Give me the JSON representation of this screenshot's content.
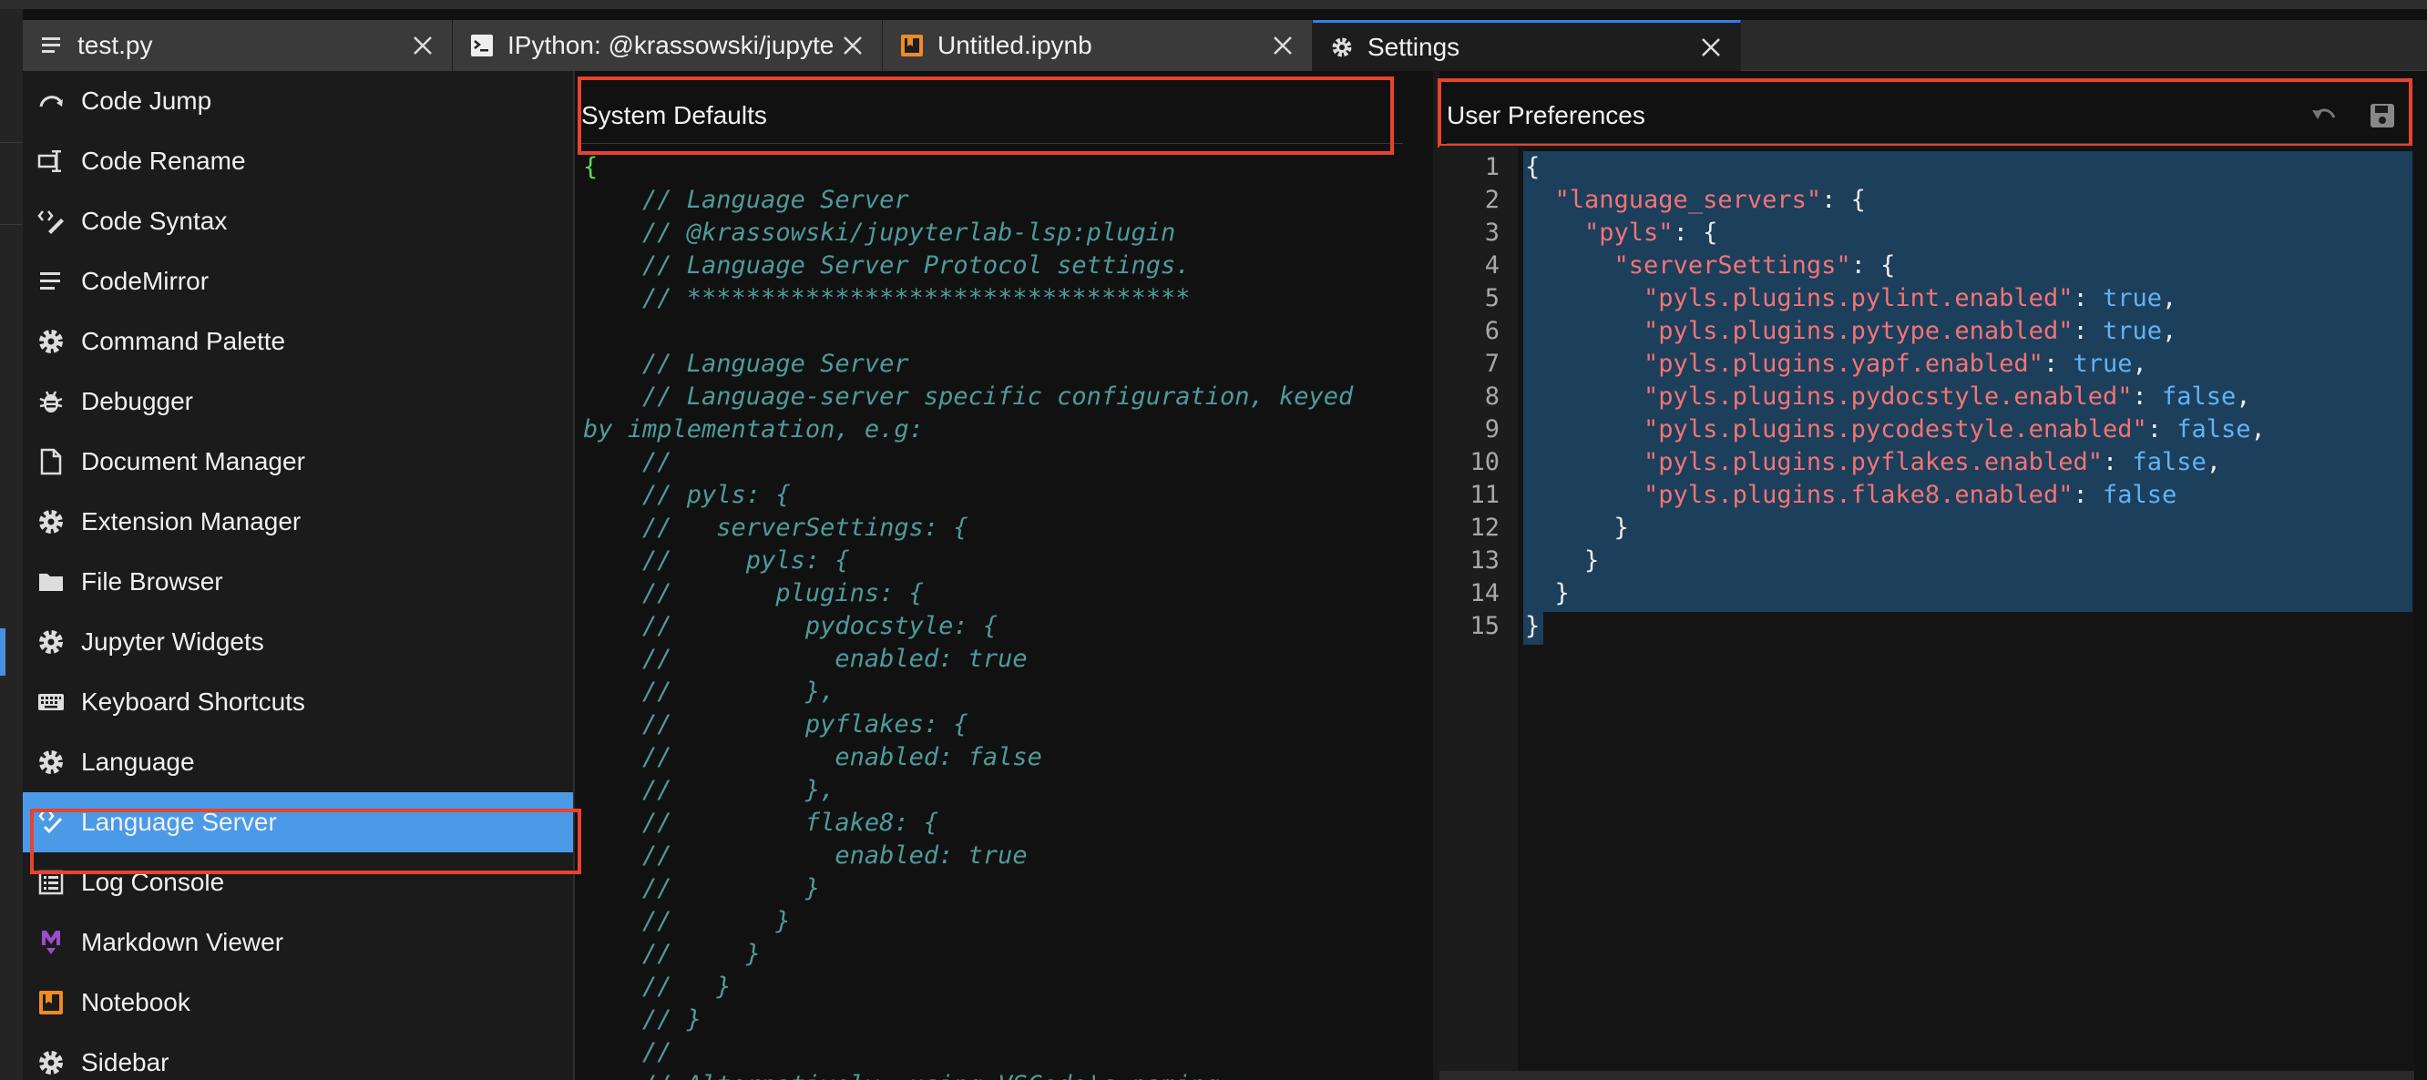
{
  "tabs": [
    {
      "label": "test.py",
      "icon": "text-file-icon"
    },
    {
      "label": "IPython: @krassowski/jupyterlab-lsp",
      "icon": "terminal-icon"
    },
    {
      "label": "Untitled.ipynb",
      "icon": "notebook-icon"
    },
    {
      "label": "Settings",
      "icon": "gear-icon"
    }
  ],
  "sidebar": {
    "items": [
      {
        "label": "Code Jump",
        "icon": "jump-icon"
      },
      {
        "label": "Code Rename",
        "icon": "rename-icon"
      },
      {
        "label": "Code Syntax",
        "icon": "syntax-icon"
      },
      {
        "label": "CodeMirror",
        "icon": "lines-icon"
      },
      {
        "label": "Command Palette",
        "icon": "gear-icon"
      },
      {
        "label": "Debugger",
        "icon": "bug-icon"
      },
      {
        "label": "Document Manager",
        "icon": "document-icon"
      },
      {
        "label": "Extension Manager",
        "icon": "gear-icon"
      },
      {
        "label": "File Browser",
        "icon": "folder-icon"
      },
      {
        "label": "Jupyter Widgets",
        "icon": "gear-icon"
      },
      {
        "label": "Keyboard Shortcuts",
        "icon": "keyboard-icon"
      },
      {
        "label": "Language",
        "icon": "gear-icon"
      },
      {
        "label": "Language Server",
        "icon": "language-server-icon"
      },
      {
        "label": "Log Console",
        "icon": "list-icon"
      },
      {
        "label": "Markdown Viewer",
        "icon": "markdown-icon"
      },
      {
        "label": "Notebook",
        "icon": "notebook-icon"
      },
      {
        "label": "Sidebar",
        "icon": "gear-icon"
      }
    ],
    "selected": "Language Server"
  },
  "system_defaults": {
    "title": "System Defaults",
    "lines": [
      "{",
      "    // Language Server",
      "    // @krassowski/jupyterlab-lsp:plugin",
      "    // Language Server Protocol settings.",
      "    // **********************************",
      "",
      "    // Language Server",
      "    // Language-server specific configuration, keyed",
      "by implementation, e.g:",
      "    //",
      "    // pyls: {",
      "    //   serverSettings: {",
      "    //     pyls: {",
      "    //       plugins: {",
      "    //         pydocstyle: {",
      "    //           enabled: true",
      "    //         },",
      "    //         pyflakes: {",
      "    //           enabled: false",
      "    //         },",
      "    //         flake8: {",
      "    //           enabled: true",
      "    //         }",
      "    //       }",
      "    //     }",
      "    //   }",
      "    // }",
      "    //",
      "    // Alternatively, using VSCode's naming"
    ]
  },
  "user_preferences": {
    "title": "User Preferences",
    "line_numbers": [
      "1",
      "2",
      "3",
      "4",
      "5",
      "6",
      "7",
      "8",
      "9",
      "10",
      "11",
      "12",
      "13",
      "14",
      "15"
    ],
    "lines": [
      [
        {
          "t": "{",
          "c": "pun"
        }
      ],
      [
        {
          "t": "  ",
          "c": "pun"
        },
        {
          "t": "\"language_servers\"",
          "c": "key"
        },
        {
          "t": ": {",
          "c": "pun"
        }
      ],
      [
        {
          "t": "    ",
          "c": "pun"
        },
        {
          "t": "\"pyls\"",
          "c": "key"
        },
        {
          "t": ": {",
          "c": "pun"
        }
      ],
      [
        {
          "t": "      ",
          "c": "pun"
        },
        {
          "t": "\"serverSettings\"",
          "c": "key"
        },
        {
          "t": ": {",
          "c": "pun"
        }
      ],
      [
        {
          "t": "        ",
          "c": "pun"
        },
        {
          "t": "\"pyls.plugins.pylint.enabled\"",
          "c": "key"
        },
        {
          "t": ": ",
          "c": "pun"
        },
        {
          "t": "true",
          "c": "bool"
        },
        {
          "t": ",",
          "c": "pun"
        }
      ],
      [
        {
          "t": "        ",
          "c": "pun"
        },
        {
          "t": "\"pyls.plugins.pytype.enabled\"",
          "c": "key"
        },
        {
          "t": ": ",
          "c": "pun"
        },
        {
          "t": "true",
          "c": "bool"
        },
        {
          "t": ",",
          "c": "pun"
        }
      ],
      [
        {
          "t": "        ",
          "c": "pun"
        },
        {
          "t": "\"pyls.plugins.yapf.enabled\"",
          "c": "key"
        },
        {
          "t": ": ",
          "c": "pun"
        },
        {
          "t": "true",
          "c": "bool"
        },
        {
          "t": ",",
          "c": "pun"
        }
      ],
      [
        {
          "t": "        ",
          "c": "pun"
        },
        {
          "t": "\"pyls.plugins.pydocstyle.enabled\"",
          "c": "key"
        },
        {
          "t": ": ",
          "c": "pun"
        },
        {
          "t": "false",
          "c": "bool"
        },
        {
          "t": ",",
          "c": "pun"
        }
      ],
      [
        {
          "t": "        ",
          "c": "pun"
        },
        {
          "t": "\"pyls.plugins.pycodestyle.enabled\"",
          "c": "key"
        },
        {
          "t": ": ",
          "c": "pun"
        },
        {
          "t": "false",
          "c": "bool"
        },
        {
          "t": ",",
          "c": "pun"
        }
      ],
      [
        {
          "t": "        ",
          "c": "pun"
        },
        {
          "t": "\"pyls.plugins.pyflakes.enabled\"",
          "c": "key"
        },
        {
          "t": ": ",
          "c": "pun"
        },
        {
          "t": "false",
          "c": "bool"
        },
        {
          "t": ",",
          "c": "pun"
        }
      ],
      [
        {
          "t": "        ",
          "c": "pun"
        },
        {
          "t": "\"pyls.plugins.flake8.enabled\"",
          "c": "key"
        },
        {
          "t": ": ",
          "c": "pun"
        },
        {
          "t": "false",
          "c": "bool"
        }
      ],
      [
        {
          "t": "      }",
          "c": "pun"
        }
      ],
      [
        {
          "t": "    }",
          "c": "pun"
        }
      ],
      [
        {
          "t": "  }",
          "c": "pun"
        }
      ],
      [
        {
          "t": "}",
          "c": "pun"
        }
      ]
    ]
  },
  "colors": {
    "accent": "#4a9ae8",
    "highlight_border": "#e8432e",
    "json_key": "#f27474",
    "json_bool": "#62b3f5",
    "comment": "#4e9a9a"
  }
}
